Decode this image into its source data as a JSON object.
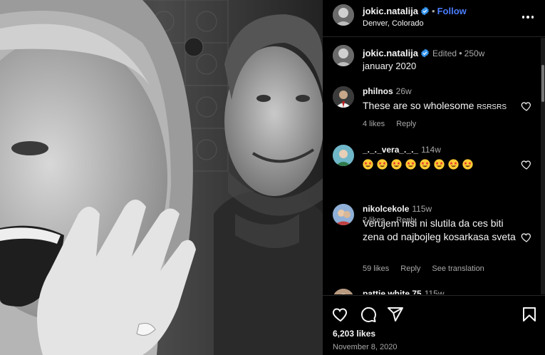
{
  "post": {
    "username": "jokic.natalija",
    "dot": "•",
    "follow_label": "Follow",
    "location": "Denver, Colorado"
  },
  "caption": {
    "username": "jokic.natalija",
    "edited_label": "Edited",
    "dot": "•",
    "age": "250w",
    "text": "january 2020"
  },
  "comments": [
    {
      "username": "philnos",
      "age": "26w",
      "text": "These are so wholesome ",
      "text_tail": "RSRSRS",
      "likes": "4 likes",
      "reply_label": "Reply"
    },
    {
      "username": "_._._vera_._._",
      "age": "114w",
      "emoji_name": "star-struck-emoji",
      "emoji_count": 8,
      "likes": "2 likes",
      "reply_label": "Reply"
    },
    {
      "username": "nikolcekole",
      "age": "115w",
      "text": "Verujem nisi ni slutila da ces biti zena od najbojleg kosarkasa sveta",
      "likes": "59 likes",
      "reply_label": "Reply",
      "translation_label": "See translation"
    },
    {
      "username": "pattie.white.75",
      "age": "115w"
    }
  ],
  "footer": {
    "likes": "6,203 likes",
    "date": "November 8, 2020"
  },
  "colors": {
    "accent": "#4a7dff",
    "verified": "#3897f0",
    "muted": "#a8a8a8",
    "background": "#000000"
  },
  "icons": [
    "verified-badge-icon",
    "more-options-icon",
    "heart-icon",
    "comment-icon",
    "share-icon",
    "bookmark-icon"
  ]
}
